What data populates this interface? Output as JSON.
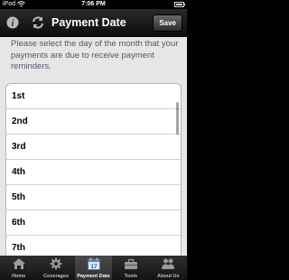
{
  "status_bar": {
    "carrier": "iPod",
    "time": "7:06 PM"
  },
  "nav_bar": {
    "title": "Payment Date",
    "save_label": "Save",
    "left_icons": [
      "info-icon",
      "sync-icon"
    ]
  },
  "instructions": "Please select the day of the month that your payments are due to receive payment reminders.",
  "day_options": [
    "1st",
    "2nd",
    "3rd",
    "4th",
    "5th",
    "6th",
    "7th"
  ],
  "tab_bar": {
    "tabs": [
      {
        "label": "Home",
        "icon": "home-icon"
      },
      {
        "label": "Coverages",
        "icon": "gear-icon"
      },
      {
        "label": "Payment Date",
        "icon": "calendar-icon",
        "calendar_number": "17",
        "active": true
      },
      {
        "label": "Tools",
        "icon": "toolbox-icon"
      },
      {
        "label": "About Us",
        "icon": "people-icon"
      }
    ]
  },
  "colors": {
    "nav_background": "#1a1a1a",
    "content_background": "#e6e6e6",
    "instruction_text": "#4d5a68"
  }
}
